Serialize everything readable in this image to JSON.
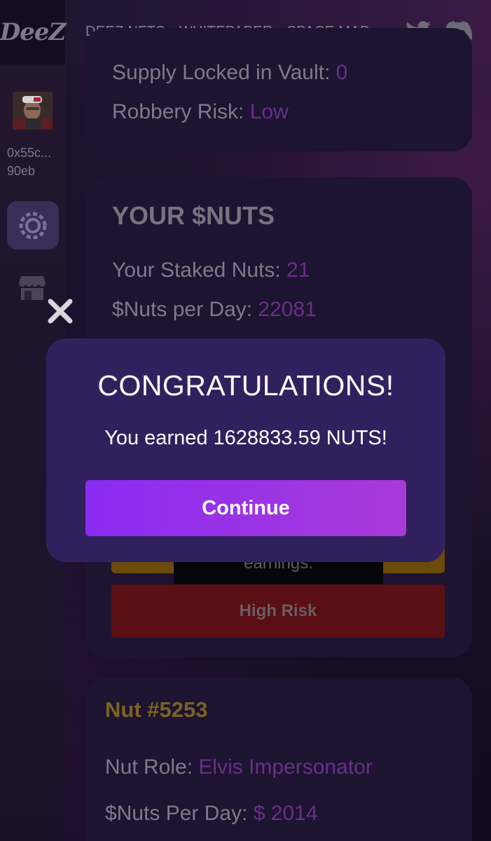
{
  "nav": {
    "logo": "DeeZ",
    "links": [
      "DEEZ NFTS",
      "WHITEPAPER",
      "SPACE MAP"
    ],
    "twitter_icon": "twitter-icon",
    "discord_icon": "discord-icon"
  },
  "sidebar": {
    "wallet_line1": "0x55c...",
    "wallet_line2": "90eb",
    "items": [
      {
        "icon": "chip-icon",
        "active": true
      },
      {
        "icon": "store-icon",
        "active": false
      }
    ]
  },
  "vault": {
    "supply_label": "Supply Locked in Vault: ",
    "supply_value": "0",
    "robbery_label": "Robbery Risk: ",
    "robbery_value": "Low"
  },
  "your_nuts": {
    "heading": "YOUR $NUTS",
    "staked_label": "Your Staked Nuts: ",
    "staked_value": "21",
    "per_day_label": "$Nuts per Day: ",
    "per_day_value": "22081",
    "tooltip_text": "earnings.",
    "high_risk_label": "High Risk"
  },
  "nut_card": {
    "heading": "Nut #5253",
    "role_label": "Nut Role: ",
    "role_value": "Elvis Impersonator",
    "per_day_label": "$Nuts Per Day: ",
    "per_day_value": "$ 2014"
  },
  "modal": {
    "title": "CONGRATULATIONS!",
    "message": "You earned 1628833.59 NUTS!",
    "continue_label": "Continue",
    "close_icon": "close-icon"
  },
  "colors": {
    "accent_purple": "#8b2cf3",
    "modal_bg": "#30215e",
    "value_purple": "#6a2f87",
    "gold": "#7a6224"
  }
}
